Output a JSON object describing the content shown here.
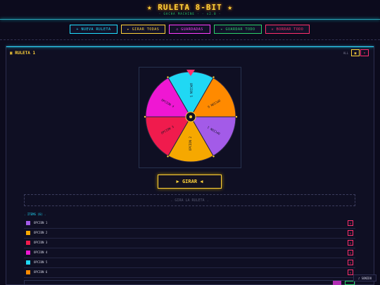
{
  "app": {
    "title": "★ RULETA 8-BIT ★",
    "subtitle": "- GACHA MACHINE - - v2.0 -"
  },
  "toolbar": [
    {
      "label": "+ NUEVA RULETA"
    },
    {
      "label": "▸ GIRAR TODAS"
    },
    {
      "label": "⌂ GUARDADAS"
    },
    {
      "label": "✦ GUARDAR TODO"
    },
    {
      "label": "✕ BORRAR TODO"
    }
  ],
  "panel": {
    "title": "▣ RULETA 1",
    "mini_label": "ALL",
    "edit_symbol": "▣",
    "close_symbol": "×"
  },
  "wheel": {
    "segments": [
      {
        "label": "OPCION 5",
        "color": "#20d8f4"
      },
      {
        "label": "OPCION 6",
        "color": "#ff8a00"
      },
      {
        "label": "OPCION 1",
        "color": "#a35be8"
      },
      {
        "label": "OPCION 2",
        "color": "#f6a800"
      },
      {
        "label": "OPCION 3",
        "color": "#f01b4d"
      },
      {
        "label": "OPCION 4",
        "color": "#ef17d3"
      }
    ],
    "pointer_color": "#ff2f6c"
  },
  "spin": {
    "label": "▶ GIRAR ◀"
  },
  "result": {
    "label": ". GIRA LA RULETA ."
  },
  "items": {
    "heading": ". ITEMS (6) .",
    "rows": [
      {
        "label": "OPCION 1",
        "color": "#a35be8"
      },
      {
        "label": "OPCION 2",
        "color": "#f6a800"
      },
      {
        "label": "OPCION 3",
        "color": "#f01b4d"
      },
      {
        "label": "OPCION 4",
        "color": "#ef17d3"
      },
      {
        "label": "OPCION 5",
        "color": "#20d8f4"
      },
      {
        "label": "OPCION 6",
        "color": "#ff8a00"
      }
    ],
    "delete_label": "×"
  },
  "sound": {
    "label": "♪ SONIDO"
  }
}
